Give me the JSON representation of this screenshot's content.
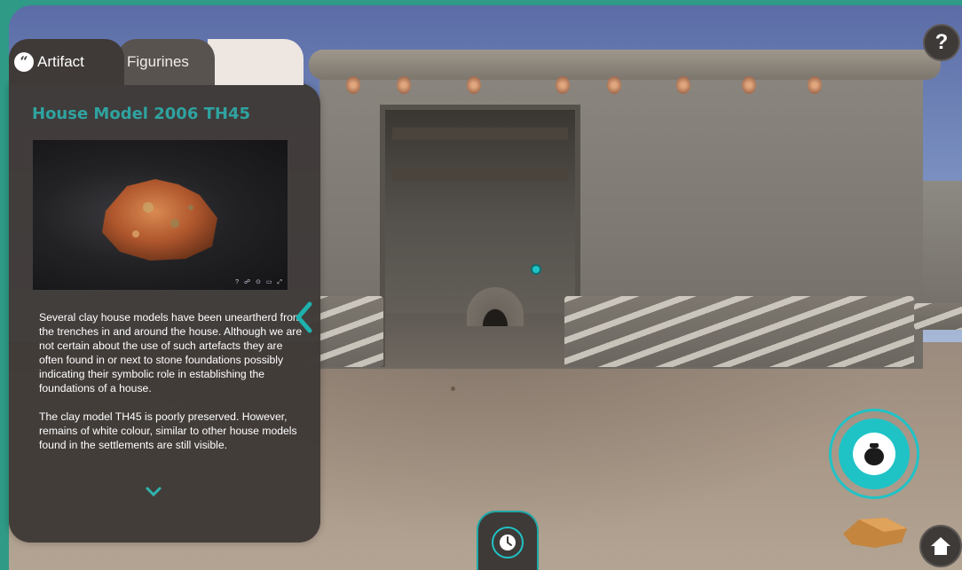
{
  "tabs": [
    {
      "label": "Artifact",
      "icon": "quote-icon",
      "active": true
    },
    {
      "label": "Figurines",
      "active": false
    }
  ],
  "panel": {
    "title": "House Model 2006 TH45",
    "viewer": {
      "controls_text": "? ☍ ⊙ ▭ ⤢"
    },
    "description": [
      "Several clay house models have been uneartherd from the trenches in and around the house. Although we are not certain about the use of such artefacts they are often found in or next to stone foundations possibly indicating their symbolic role in establishing the foundations of a house.",
      "The clay model TH45 is poorly preserved. However, remains of white colour, similar to other house models found in the settlements are still visible."
    ]
  },
  "controls": {
    "help_label": "?",
    "pot_icon": "pot-icon",
    "time_icon": "clock-icon",
    "home_icon": "home-icon"
  },
  "colors": {
    "accent": "#1fc3c6",
    "title": "#2fa3a0",
    "panel": "#3f3a37",
    "frame": "#2f9a86"
  }
}
